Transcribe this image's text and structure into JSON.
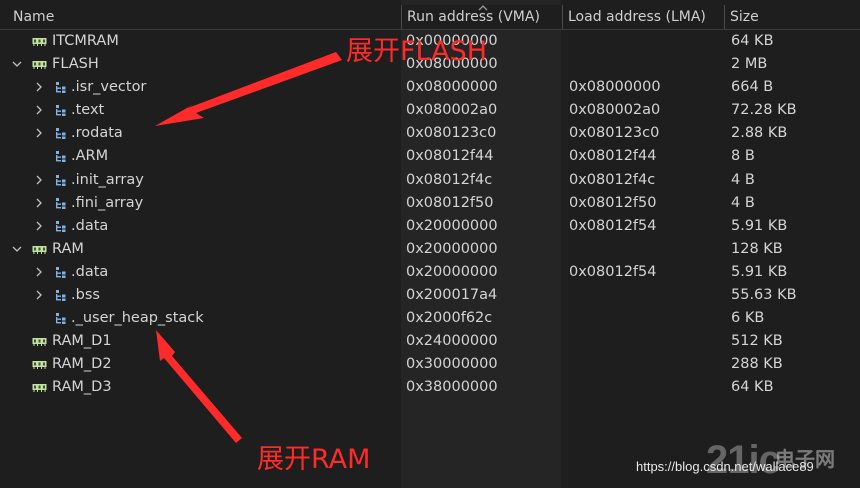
{
  "columns": {
    "name": "Name",
    "vma": "Run address (VMA)",
    "lma": "Load address (LMA)",
    "size": "Size"
  },
  "rows": [
    {
      "name": "ITCMRAM",
      "vma": "0x00000000",
      "lma": "",
      "size": "64 KB",
      "level": 0,
      "kind": "memory",
      "expander": "none"
    },
    {
      "name": "FLASH",
      "vma": "0x08000000",
      "lma": "",
      "size": "2 MB",
      "level": 0,
      "kind": "memory",
      "expander": "expanded"
    },
    {
      "name": ".isr_vector",
      "vma": "0x08000000",
      "lma": "0x08000000",
      "size": "664 B",
      "level": 1,
      "kind": "section",
      "expander": "collapsed"
    },
    {
      "name": ".text",
      "vma": "0x080002a0",
      "lma": "0x080002a0",
      "size": "72.28 KB",
      "level": 1,
      "kind": "section",
      "expander": "collapsed"
    },
    {
      "name": ".rodata",
      "vma": "0x080123c0",
      "lma": "0x080123c0",
      "size": "2.88 KB",
      "level": 1,
      "kind": "section",
      "expander": "collapsed"
    },
    {
      "name": ".ARM",
      "vma": "0x08012f44",
      "lma": "0x08012f44",
      "size": "8 B",
      "level": 1,
      "kind": "section",
      "expander": "none"
    },
    {
      "name": ".init_array",
      "vma": "0x08012f4c",
      "lma": "0x08012f4c",
      "size": "4 B",
      "level": 1,
      "kind": "section",
      "expander": "collapsed"
    },
    {
      "name": ".fini_array",
      "vma": "0x08012f50",
      "lma": "0x08012f50",
      "size": "4 B",
      "level": 1,
      "kind": "section",
      "expander": "collapsed"
    },
    {
      "name": ".data",
      "vma": "0x20000000",
      "lma": "0x08012f54",
      "size": "5.91 KB",
      "level": 1,
      "kind": "section",
      "expander": "collapsed"
    },
    {
      "name": "RAM",
      "vma": "0x20000000",
      "lma": "",
      "size": "128 KB",
      "level": 0,
      "kind": "memory",
      "expander": "expanded"
    },
    {
      "name": ".data",
      "vma": "0x20000000",
      "lma": "0x08012f54",
      "size": "5.91 KB",
      "level": 1,
      "kind": "section",
      "expander": "collapsed"
    },
    {
      "name": ".bss",
      "vma": "0x200017a4",
      "lma": "",
      "size": "55.63 KB",
      "level": 1,
      "kind": "section",
      "expander": "collapsed"
    },
    {
      "name": "._user_heap_stack",
      "vma": "0x2000f62c",
      "lma": "",
      "size": "6 KB",
      "level": 1,
      "kind": "section",
      "expander": "none"
    },
    {
      "name": "RAM_D1",
      "vma": "0x24000000",
      "lma": "",
      "size": "512 KB",
      "level": 0,
      "kind": "memory",
      "expander": "none"
    },
    {
      "name": "RAM_D2",
      "vma": "0x30000000",
      "lma": "",
      "size": "288 KB",
      "level": 0,
      "kind": "memory",
      "expander": "none"
    },
    {
      "name": "RAM_D3",
      "vma": "0x38000000",
      "lma": "",
      "size": "64 KB",
      "level": 0,
      "kind": "memory",
      "expander": "none"
    }
  ],
  "annotations": {
    "flash": "展开FLASH",
    "ram": "展开RAM"
  },
  "watermark": {
    "url": "https://blog.csdn.net/wallace89",
    "logo_number": "21ic",
    "logo_text": "电子网"
  },
  "colors": {
    "background": "#1e1e1e",
    "shaded_column": "#252526",
    "text": "#d4d4d4",
    "annotation_red": "#ff2a2a",
    "memory_icon": "#c5e0a5",
    "section_icon": "#7fb2e6"
  }
}
